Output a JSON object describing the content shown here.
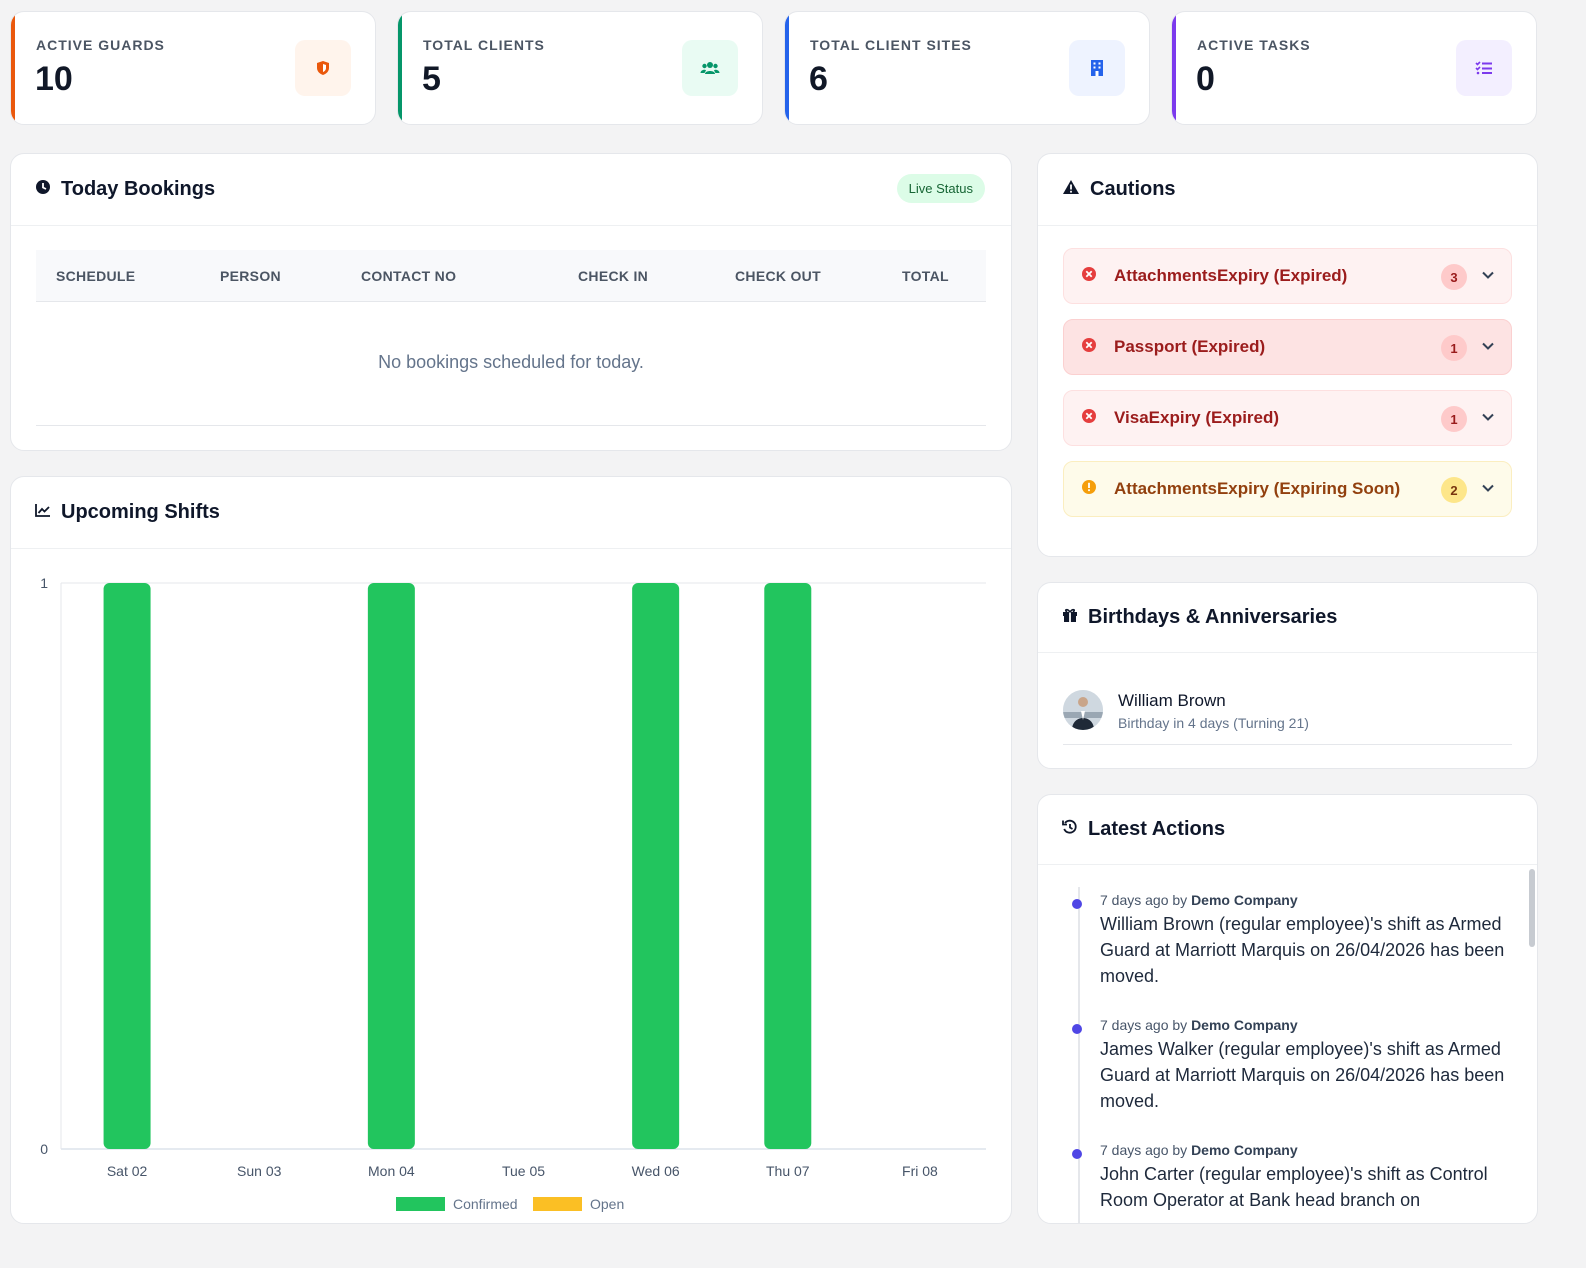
{
  "stats": [
    {
      "label": "ACTIVE GUARDS",
      "value": "10",
      "color": "#ea580c",
      "icon": "shield-icon"
    },
    {
      "label": "TOTAL CLIENTS",
      "value": "5",
      "color": "#059669",
      "icon": "users-icon"
    },
    {
      "label": "TOTAL CLIENT SITES",
      "value": "6",
      "color": "#2563eb",
      "icon": "building-icon"
    },
    {
      "label": "ACTIVE TASKS",
      "value": "0",
      "color": "#7c3aed",
      "icon": "task-list-icon"
    }
  ],
  "bookings": {
    "title": "Today Bookings",
    "live_label": "Live Status",
    "columns": [
      "SCHEDULE",
      "PERSON",
      "CONTACT NO",
      "CHECK IN",
      "CHECK OUT",
      "TOTAL"
    ],
    "empty_message": "No bookings scheduled for today."
  },
  "shifts": {
    "title": "Upcoming Shifts"
  },
  "chart_data": {
    "type": "bar",
    "categories": [
      "Sat 02",
      "Sun 03",
      "Mon 04",
      "Tue 05",
      "Wed 06",
      "Thu 07",
      "Fri 08"
    ],
    "series": [
      {
        "name": "Confirmed",
        "values": [
          1,
          0,
          1,
          0,
          1,
          1,
          0
        ],
        "color": "#22c55e"
      },
      {
        "name": "Open",
        "values": [
          0,
          0,
          0,
          0,
          0,
          0,
          0
        ],
        "color": "#fbbf24"
      }
    ],
    "yticks": [
      "0",
      "1"
    ],
    "ylim": [
      0,
      1
    ],
    "legend": "bottom",
    "grid": true
  },
  "cautions": {
    "title": "Cautions",
    "items": [
      {
        "label": "AttachmentsExpiry (Expired)",
        "count": "3",
        "level": "expired"
      },
      {
        "label": "Passport (Expired)",
        "count": "1",
        "level": "expired"
      },
      {
        "label": "VisaExpiry (Expired)",
        "count": "1",
        "level": "expired"
      },
      {
        "label": "AttachmentsExpiry (Expiring Soon)",
        "count": "2",
        "level": "soon"
      }
    ]
  },
  "birthdays": {
    "title": "Birthdays & Anniversaries",
    "items": [
      {
        "name": "William Brown",
        "detail": "Birthday in 4 days (Turning 21)"
      }
    ]
  },
  "actions": {
    "title": "Latest Actions",
    "items": [
      {
        "time": "7 days ago by",
        "author": "Demo Company",
        "text": "William Brown (regular employee)'s shift as Armed Guard at Marriott Marquis on 26/04/2026 has been moved."
      },
      {
        "time": "7 days ago by",
        "author": "Demo Company",
        "text": "James Walker (regular employee)'s shift as Armed Guard at Marriott Marquis on 26/04/2026 has been moved."
      },
      {
        "time": "7 days ago by",
        "author": "Demo Company",
        "text": "John Carter (regular employee)'s shift as Control Room Operator at Bank head branch on"
      }
    ]
  }
}
